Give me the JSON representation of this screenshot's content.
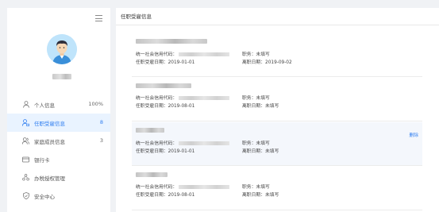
{
  "sidebar": {
    "nav": [
      {
        "label": "个人信息",
        "count": "100%",
        "icon": "user-icon",
        "active": false
      },
      {
        "label": "任职受雇信息",
        "count": "8",
        "icon": "briefcase-user-icon",
        "active": true
      },
      {
        "label": "家庭成员信息",
        "count": "3",
        "icon": "family-icon",
        "active": false
      },
      {
        "label": "银行卡",
        "count": "",
        "icon": "bank-card-icon",
        "active": false
      },
      {
        "label": "办税授权管理",
        "count": "",
        "icon": "authorization-icon",
        "active": false
      },
      {
        "label": "安全中心",
        "count": "",
        "icon": "shield-icon",
        "active": false
      }
    ]
  },
  "main": {
    "title": "任职受雇信息",
    "delete_label": "删除",
    "records": [
      {
        "code_label": "统一社会信用代码：",
        "start_label": "任职受雇日期：",
        "start_date": "2019-01-01",
        "position_label": "职务：",
        "position": "未填写",
        "end_label": "离职日期：",
        "end_date": "2019-09-02"
      },
      {
        "code_label": "统一社会信用代码：",
        "start_label": "任职受雇日期：",
        "start_date": "2019-08-01",
        "position_label": "职务：",
        "position": "未填写",
        "end_label": "离职日期：",
        "end_date": "未填写"
      },
      {
        "code_label": "统一社会信用代码：",
        "start_label": "任职受雇日期：",
        "start_date": "2019-01-01",
        "position_label": "职务：",
        "position": "未填写",
        "end_label": "离职日期：",
        "end_date": "未填写"
      },
      {
        "code_label": "统一社会信用代码：",
        "start_label": "任职受雇日期：",
        "start_date": "2019-08-01",
        "position_label": "职务：",
        "position": "未填写",
        "end_label": "离职日期：",
        "end_date": "未填写"
      }
    ]
  },
  "colors": {
    "accent": "#2f7ef0",
    "active_bg": "#e9f3ff",
    "page_bg": "#f0f2f5"
  }
}
